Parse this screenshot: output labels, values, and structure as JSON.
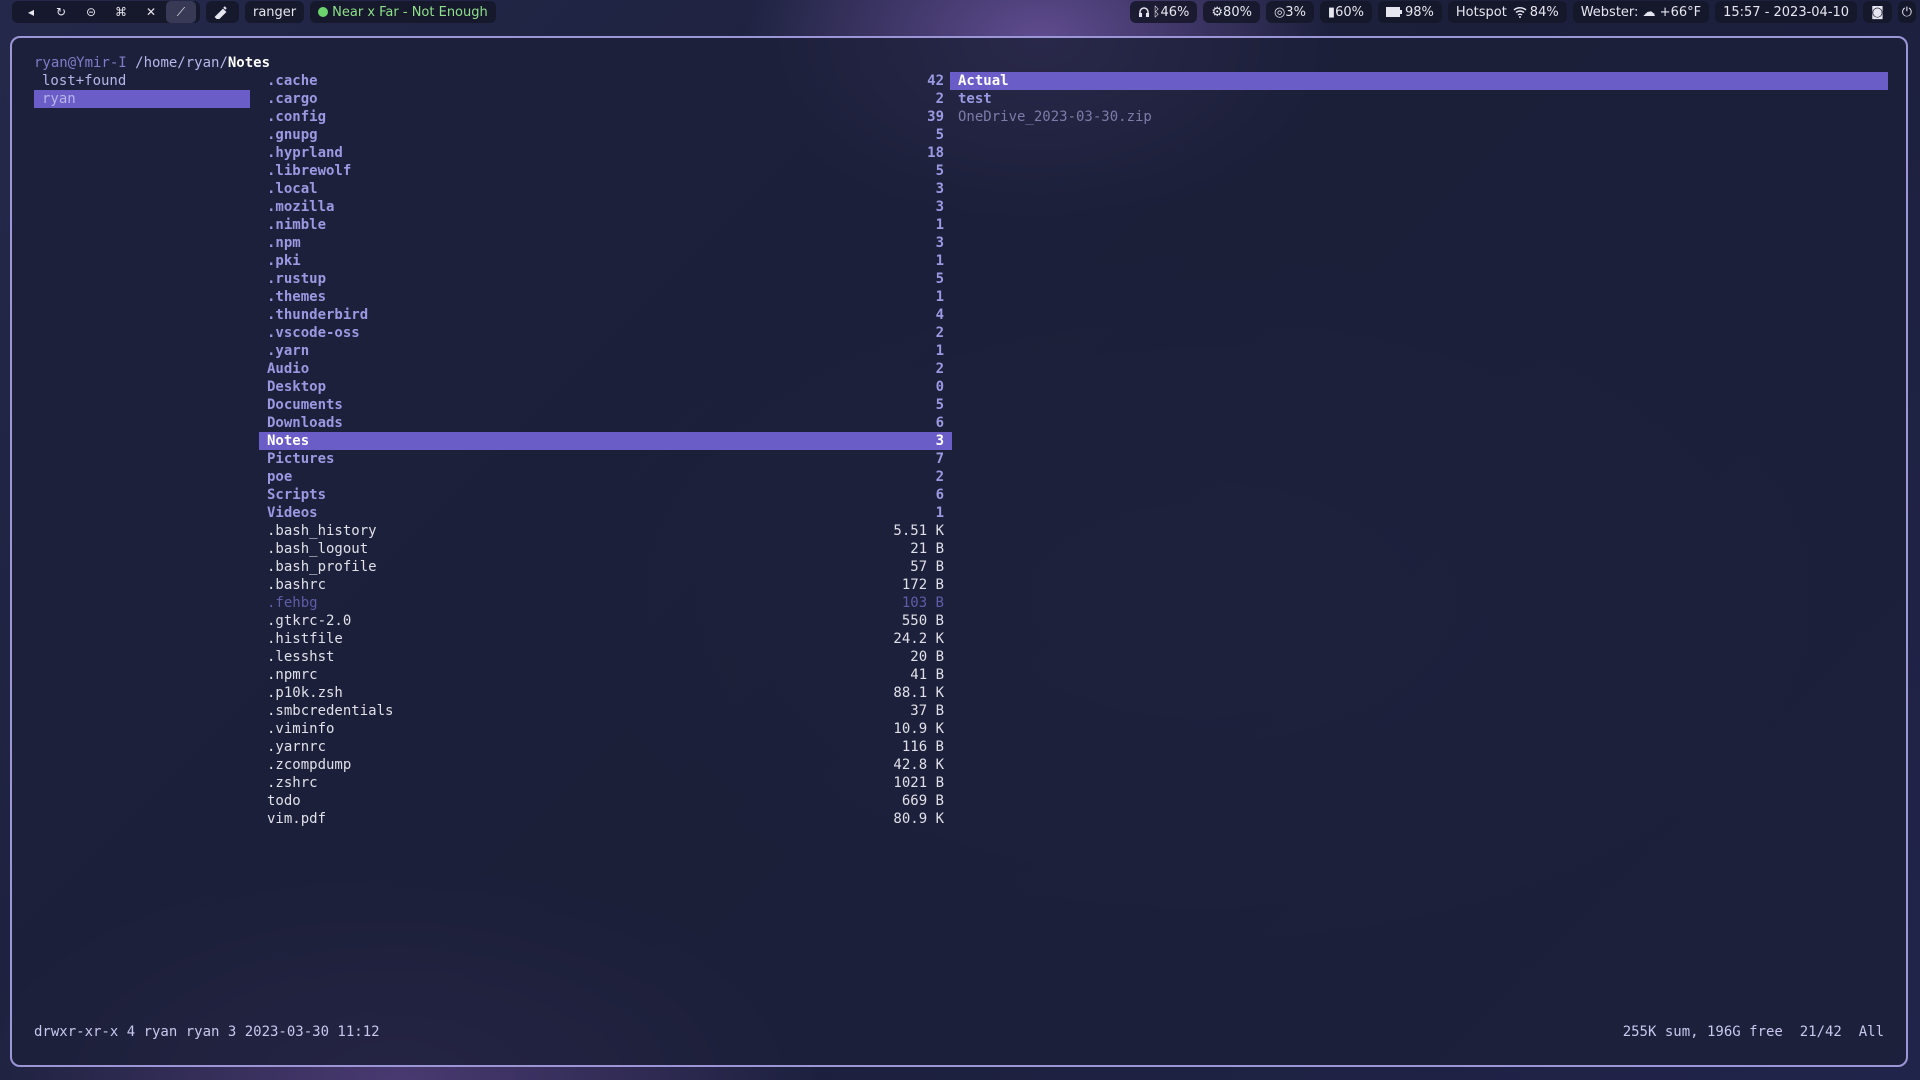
{
  "topbar": {
    "workspaces": [
      "◂",
      "↻",
      "⊝",
      "⌘",
      "✕",
      "⟋"
    ],
    "app_name": "ranger",
    "now_playing": "Near x Far - Not Enough",
    "headphones": "46%",
    "cpu": "80%",
    "gpu": "3%",
    "memory": "60%",
    "battery": "98%",
    "wifi_name": "Hotspot",
    "wifi_strength": "84%",
    "weather": "Webster: ☁ +66°F",
    "datetime": "15:57 - 2023-04-10"
  },
  "terminal": {
    "path_host": "ryan@Ymir-I",
    "path_dir": "/home/ryan/",
    "path_current": "Notes",
    "parent_column": [
      {
        "name": "lost+found",
        "selected": false
      },
      {
        "name": "ryan",
        "selected": true
      }
    ],
    "main_column": [
      {
        "name": ".cache",
        "size": "42",
        "kind": "dir"
      },
      {
        "name": ".cargo",
        "size": "2",
        "kind": "dir"
      },
      {
        "name": ".config",
        "size": "39",
        "kind": "dir"
      },
      {
        "name": ".gnupg",
        "size": "5",
        "kind": "dir"
      },
      {
        "name": ".hyprland",
        "size": "18",
        "kind": "dir"
      },
      {
        "name": ".librewolf",
        "size": "5",
        "kind": "dir"
      },
      {
        "name": ".local",
        "size": "3",
        "kind": "dir"
      },
      {
        "name": ".mozilla",
        "size": "3",
        "kind": "dir"
      },
      {
        "name": ".nimble",
        "size": "1",
        "kind": "dir"
      },
      {
        "name": ".npm",
        "size": "3",
        "kind": "dir"
      },
      {
        "name": ".pki",
        "size": "1",
        "kind": "dir"
      },
      {
        "name": ".rustup",
        "size": "5",
        "kind": "dir"
      },
      {
        "name": ".themes",
        "size": "1",
        "kind": "dir"
      },
      {
        "name": ".thunderbird",
        "size": "4",
        "kind": "dir"
      },
      {
        "name": ".vscode-oss",
        "size": "2",
        "kind": "dir"
      },
      {
        "name": ".yarn",
        "size": "1",
        "kind": "dir"
      },
      {
        "name": "Audio",
        "size": "2",
        "kind": "dir"
      },
      {
        "name": "Desktop",
        "size": "0",
        "kind": "dir"
      },
      {
        "name": "Documents",
        "size": "5",
        "kind": "dir"
      },
      {
        "name": "Downloads",
        "size": "6",
        "kind": "dir"
      },
      {
        "name": "Notes",
        "size": "3",
        "kind": "selected"
      },
      {
        "name": "Pictures",
        "size": "7",
        "kind": "dir"
      },
      {
        "name": "poe",
        "size": "2",
        "kind": "dir"
      },
      {
        "name": "Scripts",
        "size": "6",
        "kind": "dir"
      },
      {
        "name": "Videos",
        "size": "1",
        "kind": "dir"
      },
      {
        "name": ".bash_history",
        "size": "5.51 K",
        "kind": "file"
      },
      {
        "name": ".bash_logout",
        "size": "21 B",
        "kind": "file"
      },
      {
        "name": ".bash_profile",
        "size": "57 B",
        "kind": "file"
      },
      {
        "name": ".bashrc",
        "size": "172 B",
        "kind": "file"
      },
      {
        "name": ".fehbg",
        "size": "103 B",
        "kind": "exec"
      },
      {
        "name": ".gtkrc-2.0",
        "size": "550 B",
        "kind": "file"
      },
      {
        "name": ".histfile",
        "size": "24.2 K",
        "kind": "file"
      },
      {
        "name": ".lesshst",
        "size": "20 B",
        "kind": "file"
      },
      {
        "name": ".npmrc",
        "size": "41 B",
        "kind": "file"
      },
      {
        "name": ".p10k.zsh",
        "size": "88.1 K",
        "kind": "file"
      },
      {
        "name": ".smbcredentials",
        "size": "37 B",
        "kind": "file"
      },
      {
        "name": ".viminfo",
        "size": "10.9 K",
        "kind": "file"
      },
      {
        "name": ".yarnrc",
        "size": "116 B",
        "kind": "file"
      },
      {
        "name": ".zcompdump",
        "size": "42.8 K",
        "kind": "file"
      },
      {
        "name": ".zshrc",
        "size": "1021 B",
        "kind": "file"
      },
      {
        "name": "todo",
        "size": "669 B",
        "kind": "file"
      },
      {
        "name": "vim.pdf",
        "size": "80.9 K",
        "kind": "file"
      }
    ],
    "preview_column": [
      {
        "name": "Actual",
        "kind": "selected"
      },
      {
        "name": "test",
        "kind": "dir"
      },
      {
        "name": "OneDrive_2023-03-30.zip",
        "kind": "faded"
      }
    ],
    "status_left": "drwxr-xr-x 4 ryan ryan 3 2023-03-30 11:12",
    "status_right": "255K sum, 196G free  21/42  All"
  }
}
